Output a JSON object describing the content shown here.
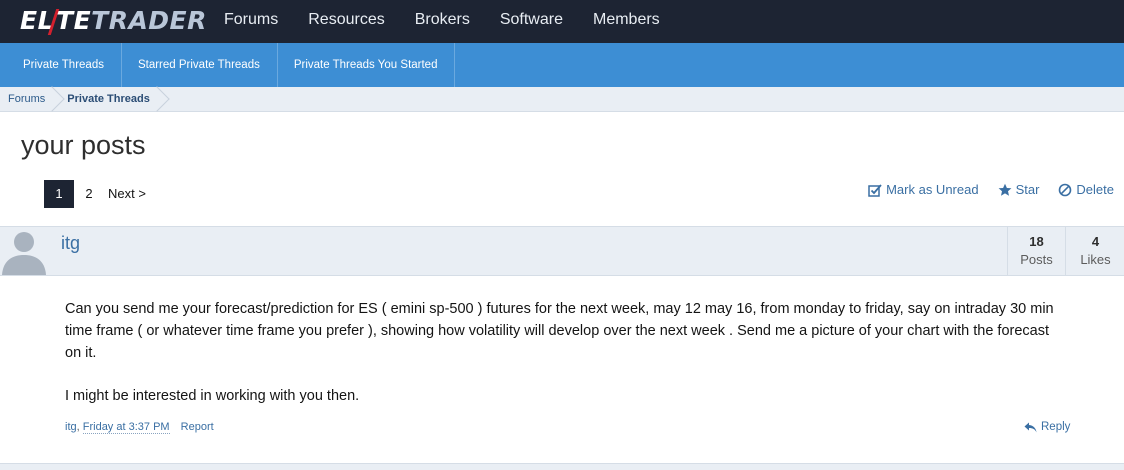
{
  "header": {
    "logo_left": "EL",
    "logo_mid": "TE",
    "logo_right": "TRADER",
    "nav": [
      "Forums",
      "Resources",
      "Brokers",
      "Software",
      "Members"
    ]
  },
  "subnav": {
    "tabs": [
      "Private Threads",
      "Starred Private Threads",
      "Private Threads You Started"
    ]
  },
  "breadcrumb": {
    "items": [
      "Forums",
      "Private Threads"
    ]
  },
  "page": {
    "title": "your posts"
  },
  "pager": {
    "current": "1",
    "page2": "2",
    "next": "Next >"
  },
  "actions": {
    "mark_unread": "Mark as Unread",
    "star": "Star",
    "delete": "Delete"
  },
  "message": {
    "username": "itg",
    "posts_count": "18",
    "posts_label": "Posts",
    "likes_count": "4",
    "likes_label": "Likes",
    "paragraph1": "Can you send me your forecast/prediction for ES ( emini sp-500 ) futures for the next week, may 12 may 16, from monday to friday, say on intraday 30 min time frame ( or whatever time frame you prefer ), showing how volatility will develop over the next week . Send me a picture of your chart with the forecast on it.",
    "paragraph2": "I might be interested in working with you then.",
    "footer_author": "itg",
    "footer_sep": ", ",
    "footer_time": "Friday at 3:37 PM",
    "report": "Report",
    "reply": "Reply"
  },
  "colors": {
    "topbar": "#1d2433",
    "subnav": "#3d8ed4",
    "link": "#3a6fa3",
    "logo_accent": "#d3202e"
  }
}
